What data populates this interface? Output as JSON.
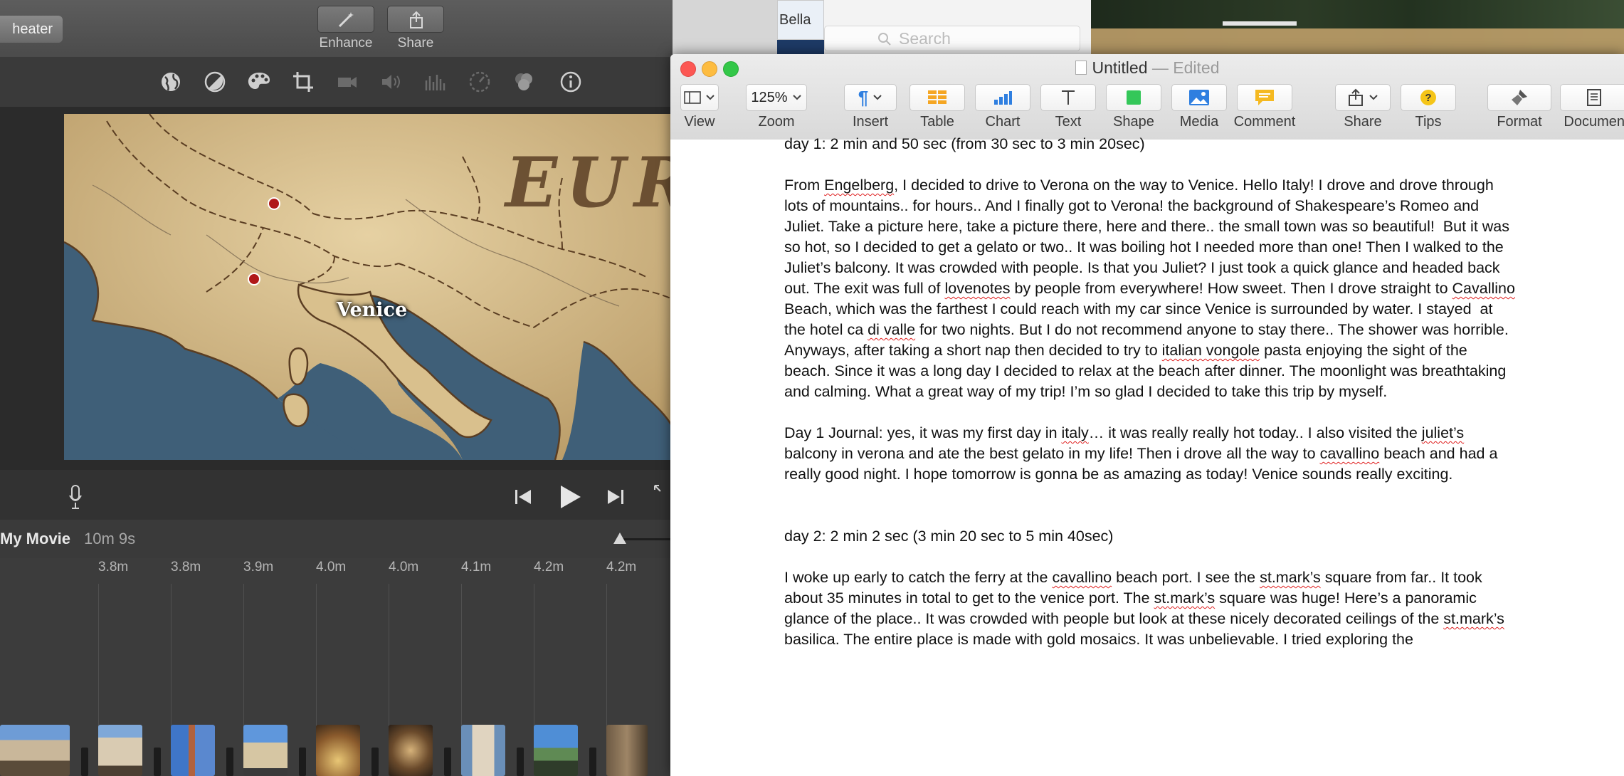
{
  "imovie": {
    "theater_label": "heater",
    "enhance_label": "Enhance",
    "share_label": "Share",
    "map_title": "EUR",
    "map_place": "Venice",
    "project_title": "My Movie",
    "project_duration": "10m 9s",
    "clip_durations": [
      "3.8m",
      "3.8m",
      "3.9m",
      "4.0m",
      "4.0m",
      "4.1m",
      "4.2m",
      "4.2m"
    ]
  },
  "background": {
    "bella_text": "Bella",
    "search_placeholder": "Search"
  },
  "pages": {
    "window_title": "Untitled",
    "window_separator": "—",
    "window_status": "Edited",
    "toolbar": {
      "view": "View",
      "zoom": "Zoom",
      "zoom_value": "125%",
      "insert": "Insert",
      "table": "Table",
      "chart": "Chart",
      "text": "Text",
      "shape": "Shape",
      "media": "Media",
      "comment": "Comment",
      "share": "Share",
      "tips": "Tips",
      "format": "Format",
      "document": "Document"
    },
    "document": {
      "day1_heading": "day 1: 2 min and 50 sec (from 30 sec to 3 min 20sec)",
      "day1_journal_label": "Day 1 Journal: yes, it was my first day in ",
      "day2_heading": "day 2: 2 min 2 sec (3 min 20 sec to 5 min 40sec)"
    }
  },
  "colors": {
    "close": "#fc5753",
    "minimize": "#fdbc40",
    "zoom": "#33c748",
    "accent_blue": "#2f7fe0",
    "spell_red": "#e02020"
  }
}
